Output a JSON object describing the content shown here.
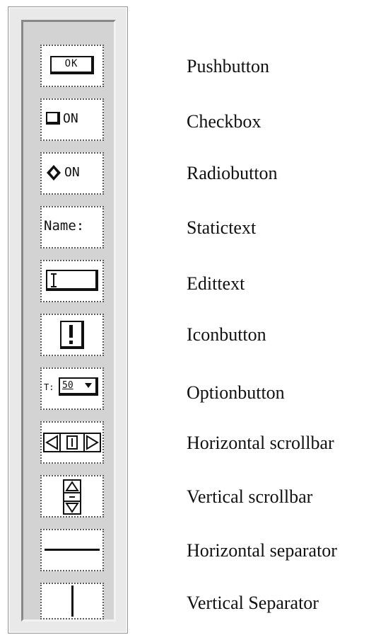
{
  "palette": {
    "pushbutton_text": "OK",
    "checkbox_text": "ON",
    "radiobutton_text": "ON",
    "statictext_text": "Name:",
    "optionbutton_prefix": "T:",
    "optionbutton_value": "50"
  },
  "labels": {
    "pushbutton": "Pushbutton",
    "checkbox": "Checkbox",
    "radiobutton": "Radiobutton",
    "statictext": "Statictext",
    "edittext": "Edittext",
    "iconbutton": "Iconbutton",
    "optionbutton": "Optionbutton",
    "hscrollbar": "Horizontal scrollbar",
    "vscrollbar": "Vertical scrollbar",
    "hseparator": "Horizontal separator",
    "vseparator": "Vertical Separator"
  }
}
